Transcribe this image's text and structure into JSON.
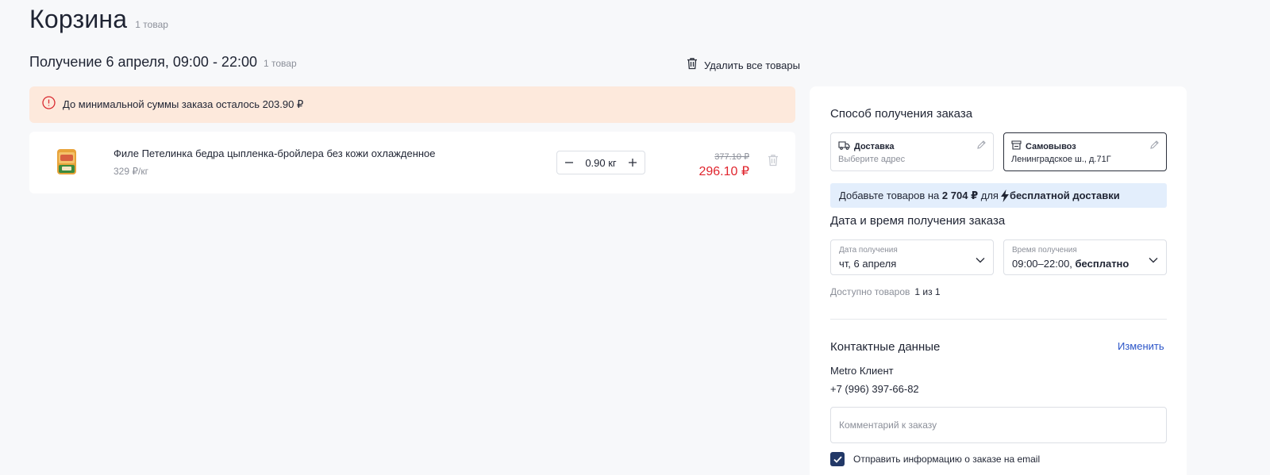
{
  "header": {
    "title": "Корзина",
    "count": "1 товар"
  },
  "receipt": {
    "title": "Получение 6 апреля, 09:00 - 22:00",
    "count": "1 товар",
    "delete_all_label": "Удалить все товары"
  },
  "warning": {
    "text": "До минимальной суммы заказа осталось 203.90 ₽",
    "icon": "info-circle-icon"
  },
  "cart_item": {
    "name": "Филе Петелинка бедра цыпленка-бройлера без кожи охлажденное",
    "unit_price": "329 ₽/кг",
    "quantity": "0.90 кг",
    "old_price": "377.10 ₽",
    "new_price": "296.10 ₽"
  },
  "delivery_method": {
    "title": "Способ получения заказа",
    "options": [
      {
        "title": "Доставка",
        "subtitle": "Выберите адрес",
        "icon": "truck-icon",
        "selected": false
      },
      {
        "title": "Самовывоз",
        "subtitle": "Ленинградское ш., д.71Г",
        "icon": "store-icon",
        "selected": true
      }
    ]
  },
  "free_delivery": {
    "prefix": "Добавьте товаров на",
    "amount": "2 704 ₽",
    "middle": "для",
    "suffix": "бесплатной доставки"
  },
  "datetime": {
    "title": "Дата и время получения заказа",
    "date_label": "Дата получения",
    "date_value": "чт, 6 апреля",
    "time_label": "Время получения",
    "time_value": "09:00–22:00,",
    "time_value_bold": "бесплатно",
    "available_label": "Доступно товаров",
    "available_value": "1 из 1"
  },
  "contacts": {
    "title": "Контактные данные",
    "change_link": "Изменить",
    "name": "Metro Клиент",
    "phone": "+7 (996) 397-66-82",
    "comment_placeholder": "Комментарий к заказу",
    "email_checkbox_label": "Отправить информацию о заказе на email",
    "email_checked": true
  },
  "colors": {
    "accent_red": "#e0252e",
    "warning_bg": "#fde9dc",
    "banner_bg": "#e3eefc",
    "link_blue": "#2b55c8",
    "checkbox_navy": "#223867"
  }
}
